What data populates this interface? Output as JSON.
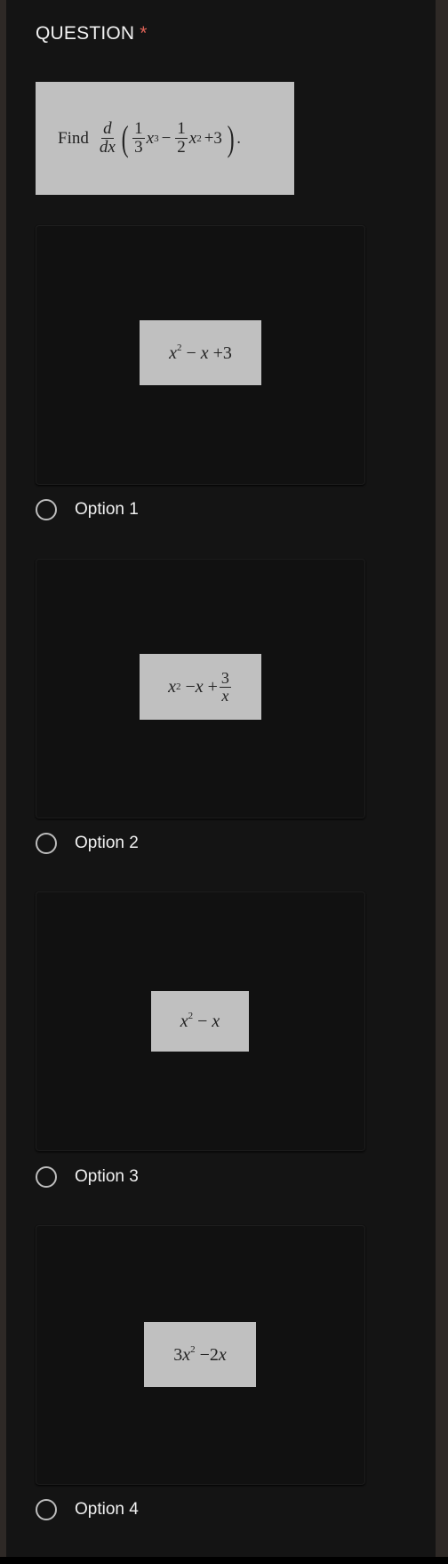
{
  "question": {
    "title": "QUESTION",
    "required_mark": "*",
    "prompt_image_text": "Find d/dx(1/3 x^3 - 1/2 x^2 + 3)."
  },
  "options": [
    {
      "label": "Option 1",
      "image_text": "x^2 - x + 3"
    },
    {
      "label": "Option 2",
      "image_text": "x^2 - x + 3/x"
    },
    {
      "label": "Option 3",
      "image_text": "x^2 - x"
    },
    {
      "label": "Option 4",
      "image_text": "3x^2 - 2x"
    }
  ],
  "colors": {
    "background": "#141414",
    "required": "#e06358",
    "image_background": "#c0c0c0"
  }
}
